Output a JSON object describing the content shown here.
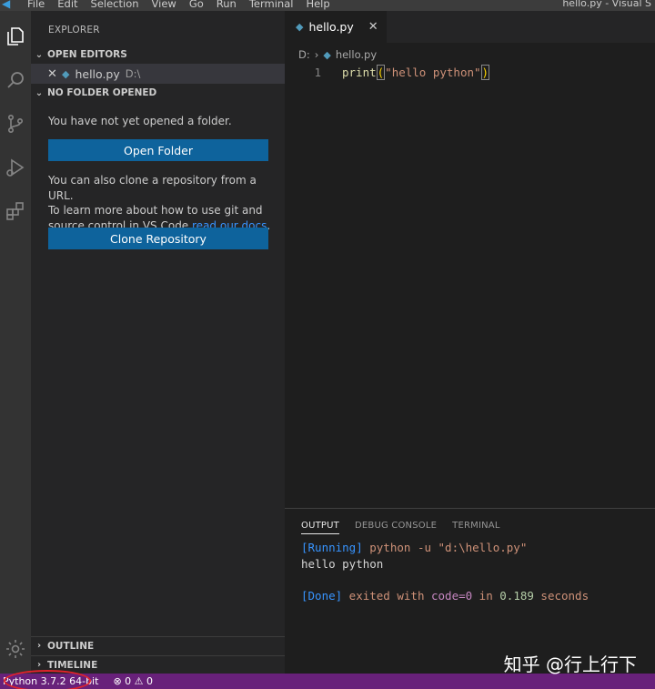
{
  "titlebar": {
    "menu": [
      "File",
      "Edit",
      "Selection",
      "View",
      "Go",
      "Run",
      "Terminal",
      "Help"
    ],
    "window_title": "hello.py - Visual S"
  },
  "activity_bar": {
    "icons": [
      "explorer-icon",
      "search-icon",
      "source-control-icon",
      "run-debug-icon",
      "extensions-icon",
      "settings-gear-icon"
    ]
  },
  "sidebar": {
    "title": "EXPLORER",
    "open_editors": {
      "header": "OPEN EDITORS",
      "item": {
        "name": "hello.py",
        "path": "D:\\"
      }
    },
    "no_folder": {
      "header": "NO FOLDER OPENED",
      "message": "You have not yet opened a folder.",
      "open_folder_button": "Open Folder",
      "clone_text_1": "You can also clone a repository from a URL.",
      "clone_text_2": "To learn more about how to use git and",
      "clone_text_3": "source control in VS Code ",
      "clone_link": "read our docs",
      "clone_text_end": ".",
      "clone_button": "Clone Repository"
    },
    "outline": "OUTLINE",
    "timeline": "TIMELINE"
  },
  "editor": {
    "tab_label": "hello.py",
    "breadcrumb_root": "D:",
    "breadcrumb_file": "hello.py",
    "line_number": "1",
    "code_fn": "print",
    "code_open": "(",
    "code_str": "\"hello python\"",
    "code_close": ")"
  },
  "panel": {
    "tabs": [
      "OUTPUT",
      "DEBUG CONSOLE",
      "TERMINAL"
    ],
    "running_tag": "[Running]",
    "running_cmd": " python -u \"d:\\hello.py\"",
    "output_line": "hello python",
    "done_tag": "[Done]",
    "done_exited": " exited with ",
    "done_code": "code=0",
    "done_in": " in ",
    "done_time": "0.189",
    "done_seconds": " seconds"
  },
  "status": {
    "interpreter": "Python 3.7.2 64-bit",
    "errors": "0",
    "warnings": "0"
  },
  "watermark": "知乎 @行上行下",
  "colors": {
    "status_bar": "#68217a",
    "button": "#0e639c",
    "annotation_ellipse": "#e0232b"
  }
}
